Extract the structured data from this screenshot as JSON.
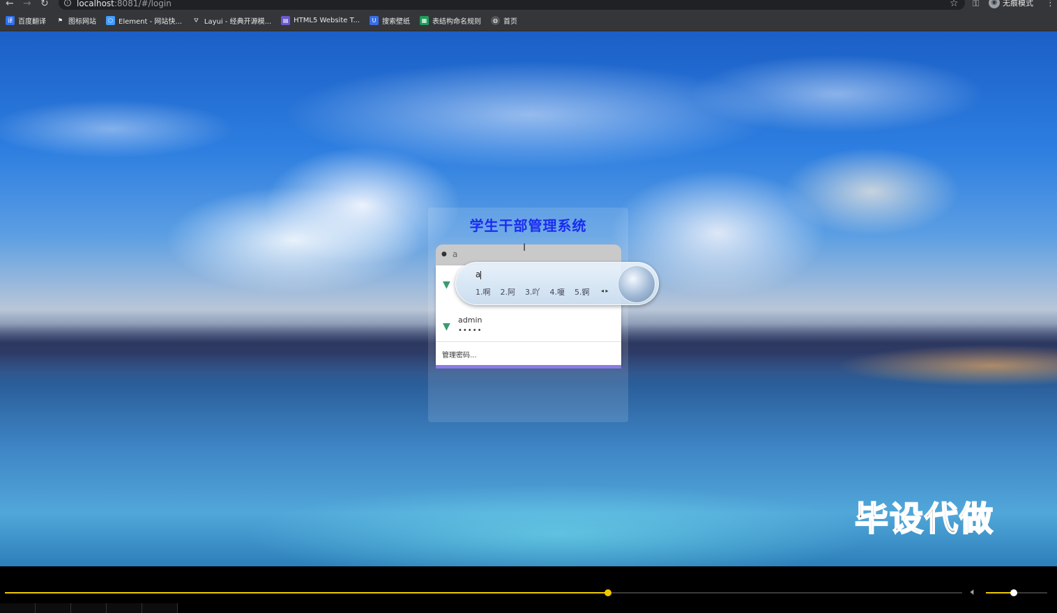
{
  "browser": {
    "url_host": "localhost",
    "url_rest": ":8081/#/login",
    "incognito_label": "无痕模式",
    "bookmarks": [
      {
        "label": "百度翻译",
        "icon": "translate-icon",
        "color": "#2d6ff0"
      },
      {
        "label": "图标网站",
        "icon": "flag-icon",
        "color": "#444444"
      },
      {
        "label": "Element - 网站快...",
        "icon": "element-icon",
        "color": "#409eff"
      },
      {
        "label": "Layui - 经典开源模...",
        "icon": "layui-icon",
        "color": "#555555"
      },
      {
        "label": "HTML5 Website T...",
        "icon": "html5-icon",
        "color": "#6a5acd"
      },
      {
        "label": "搜索壁纸",
        "icon": "wallpaper-icon",
        "color": "#3a6ee8"
      },
      {
        "label": "表结构命名规则",
        "icon": "sheet-icon",
        "color": "#1e9d5a"
      },
      {
        "label": "首页",
        "icon": "globe-icon",
        "color": "#666666"
      }
    ]
  },
  "login": {
    "title": "学生干部管理系统",
    "username_value": "a"
  },
  "autofill": {
    "entries": [
      {
        "username": "",
        "password": ""
      },
      {
        "username": "admin",
        "password": "•••••"
      }
    ],
    "manage_label": "管理密码..."
  },
  "ime": {
    "input": "a",
    "candidates": [
      "1.啊",
      "2.阿",
      "3.吖",
      "4.嗄",
      "5.锕"
    ]
  },
  "watermark": "毕设代做",
  "player": {
    "progress": 0.63,
    "volume": 0.45
  }
}
